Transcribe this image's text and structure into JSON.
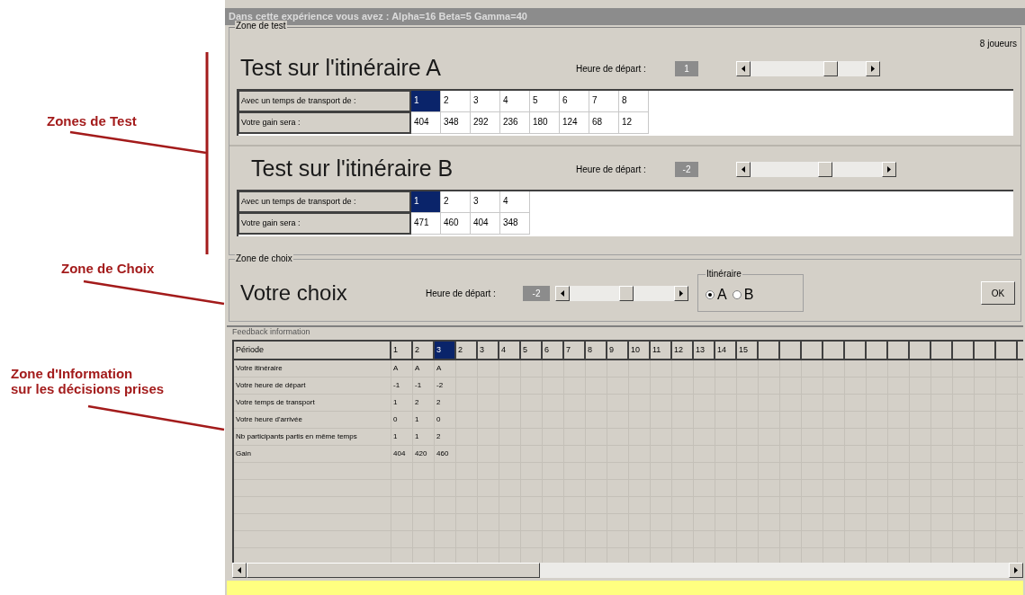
{
  "annotations": [
    {
      "lines": [
        "Zones de Test"
      ]
    },
    {
      "lines": [
        "Zone de Choix"
      ]
    },
    {
      "lines": [
        "Zone d'Information",
        "sur les décisions prises"
      ]
    }
  ],
  "window": {
    "title": "Dans cette expérience vous avez : Alpha=16 Beta=5 Gamma=40"
  },
  "test_zone": {
    "legend": "Zone de test",
    "players": "8 joueurs",
    "tests": [
      {
        "title": "Test sur l'itinéraire A",
        "departure_label": "Heure de départ :",
        "departure_value": "1",
        "level": 0.72,
        "time_label": "Avec un temps de transport de :",
        "times": [
          {
            "text": "1",
            "selected": true
          },
          {
            "text": "2",
            "selected": false
          },
          {
            "text": "3",
            "selected": false
          },
          {
            "text": "4",
            "selected": false
          },
          {
            "text": "5",
            "selected": false
          },
          {
            "text": "6",
            "selected": false
          },
          {
            "text": "7",
            "selected": false
          },
          {
            "text": "8",
            "selected": false
          }
        ],
        "gain_label": "Votre gain sera :",
        "gains": [
          "404",
          "348",
          "292",
          "236",
          "180",
          "124",
          "68",
          "12"
        ]
      },
      {
        "title": "Test sur l'itinéraire B",
        "departure_label": "Heure de départ :",
        "departure_value": "-2",
        "level": 0.58,
        "time_label": "Avec un temps de transport de :",
        "times": [
          {
            "text": "1",
            "selected": true
          },
          {
            "text": "2",
            "selected": false
          },
          {
            "text": "3",
            "selected": false
          },
          {
            "text": "4",
            "selected": false
          }
        ],
        "gain_label": "Votre gain sera :",
        "gains": [
          "471",
          "460",
          "404",
          "348"
        ]
      }
    ]
  },
  "choice_zone": {
    "legend": "Zone de choix",
    "title": "Votre choix",
    "departure_label": "Heure de départ :",
    "departure_value": "-2",
    "level": 0.55,
    "route_group": {
      "legend": "Itinéraire",
      "options": [
        {
          "label": "A",
          "selected": true
        },
        {
          "label": "B",
          "selected": false
        }
      ]
    },
    "ok_button": "OK"
  },
  "feedback": {
    "legend": "Feedback information",
    "header_label": "Période",
    "columns": [
      {
        "label": "1",
        "selected": false
      },
      {
        "label": "2",
        "selected": false
      },
      {
        "label": "3",
        "selected": true
      },
      {
        "label": "2",
        "selected": false
      },
      {
        "label": "3",
        "selected": false
      },
      {
        "label": "4",
        "selected": false
      },
      {
        "label": "5",
        "selected": false
      },
      {
        "label": "6",
        "selected": false
      },
      {
        "label": "7",
        "selected": false
      },
      {
        "label": "8",
        "selected": false
      },
      {
        "label": "9",
        "selected": false
      },
      {
        "label": "10",
        "selected": false
      },
      {
        "label": "11",
        "selected": false
      },
      {
        "label": "12",
        "selected": false
      },
      {
        "label": "13",
        "selected": false
      },
      {
        "label": "14",
        "selected": false
      },
      {
        "label": "15",
        "selected": false
      }
    ],
    "rows": [
      {
        "label": "Votre itinéraire",
        "values": [
          "A",
          "A",
          "A"
        ]
      },
      {
        "label": "Votre heure de départ",
        "values": [
          "-1",
          "-1",
          "-2"
        ]
      },
      {
        "label": "Votre temps de transport",
        "values": [
          "1",
          "2",
          "2"
        ]
      },
      {
        "label": "Votre heure d'arrivée",
        "values": [
          "0",
          "1",
          "0"
        ]
      },
      {
        "label": "Nb participants partis en même temps",
        "values": [
          "1",
          "1",
          "2"
        ]
      },
      {
        "label": "Gain",
        "values": [
          "404",
          "420",
          "460"
        ]
      }
    ]
  }
}
